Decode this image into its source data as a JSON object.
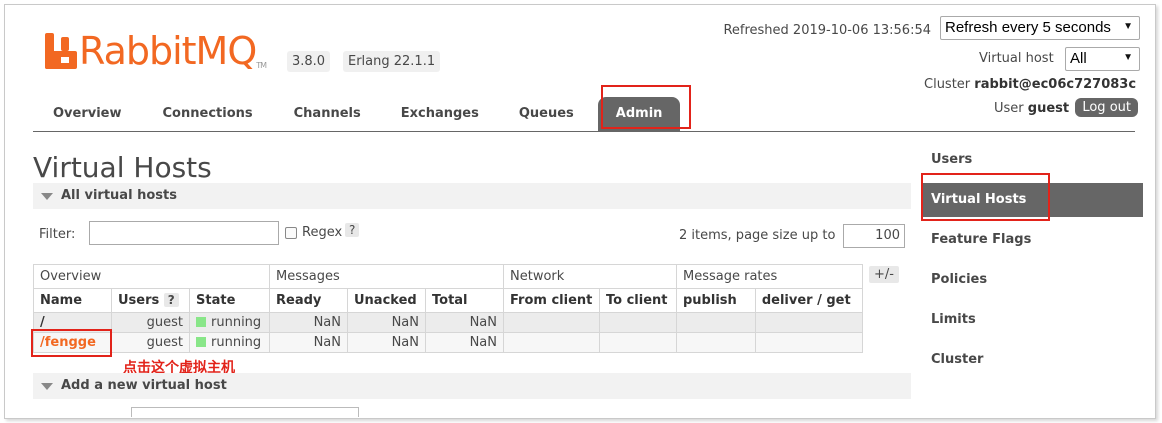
{
  "logo": {
    "text": "RabbitMQ",
    "tm": "TM",
    "brand_color": "#f26822"
  },
  "versions": {
    "rabbitmq": "3.8.0",
    "erlang": "Erlang 22.1.1"
  },
  "header": {
    "refreshed": "Refreshed 2019-10-06 13:56:54",
    "refresh_select": "Refresh every 5 seconds",
    "vhost_label": "Virtual host",
    "vhost_select": "All",
    "cluster_label": "Cluster",
    "cluster_value": "rabbit@ec06c727083c",
    "user_label": "User",
    "user_value": "guest",
    "logout": "Log out"
  },
  "tabs": [
    {
      "label": "Overview"
    },
    {
      "label": "Connections"
    },
    {
      "label": "Channels"
    },
    {
      "label": "Exchanges"
    },
    {
      "label": "Queues"
    },
    {
      "label": "Admin",
      "active": true
    }
  ],
  "page": {
    "title": "Virtual Hosts",
    "all_section": "All virtual hosts",
    "filter_label": "Filter:",
    "filter_value": "",
    "regex_label": "Regex",
    "help": "?",
    "items_text": "2 items, page size up to",
    "page_size": "100",
    "plus_minus": "+/-",
    "add_section": "Add a new virtual host",
    "annotation": "点击这个虚拟主机"
  },
  "table": {
    "groups": [
      "Overview",
      "Messages",
      "Network",
      "Message rates"
    ],
    "columns": [
      "Name",
      "Users",
      "State",
      "Ready",
      "Unacked",
      "Total",
      "From client",
      "To client",
      "publish",
      "deliver / get"
    ],
    "users_help": "?",
    "rows": [
      {
        "name": "/",
        "users": "guest",
        "state": "running",
        "ready": "NaN",
        "unacked": "NaN",
        "total": "NaN",
        "from_client": "",
        "to_client": "",
        "publish": "",
        "deliver_get": ""
      },
      {
        "name": "/fengge",
        "users": "guest",
        "state": "running",
        "ready": "NaN",
        "unacked": "NaN",
        "total": "NaN",
        "from_client": "",
        "to_client": "",
        "publish": "",
        "deliver_get": ""
      }
    ]
  },
  "sidebar": {
    "items": [
      {
        "label": "Users"
      },
      {
        "label": "Virtual Hosts",
        "active": true
      },
      {
        "label": "Feature Flags"
      },
      {
        "label": "Policies"
      },
      {
        "label": "Limits"
      },
      {
        "label": "Cluster"
      }
    ]
  }
}
